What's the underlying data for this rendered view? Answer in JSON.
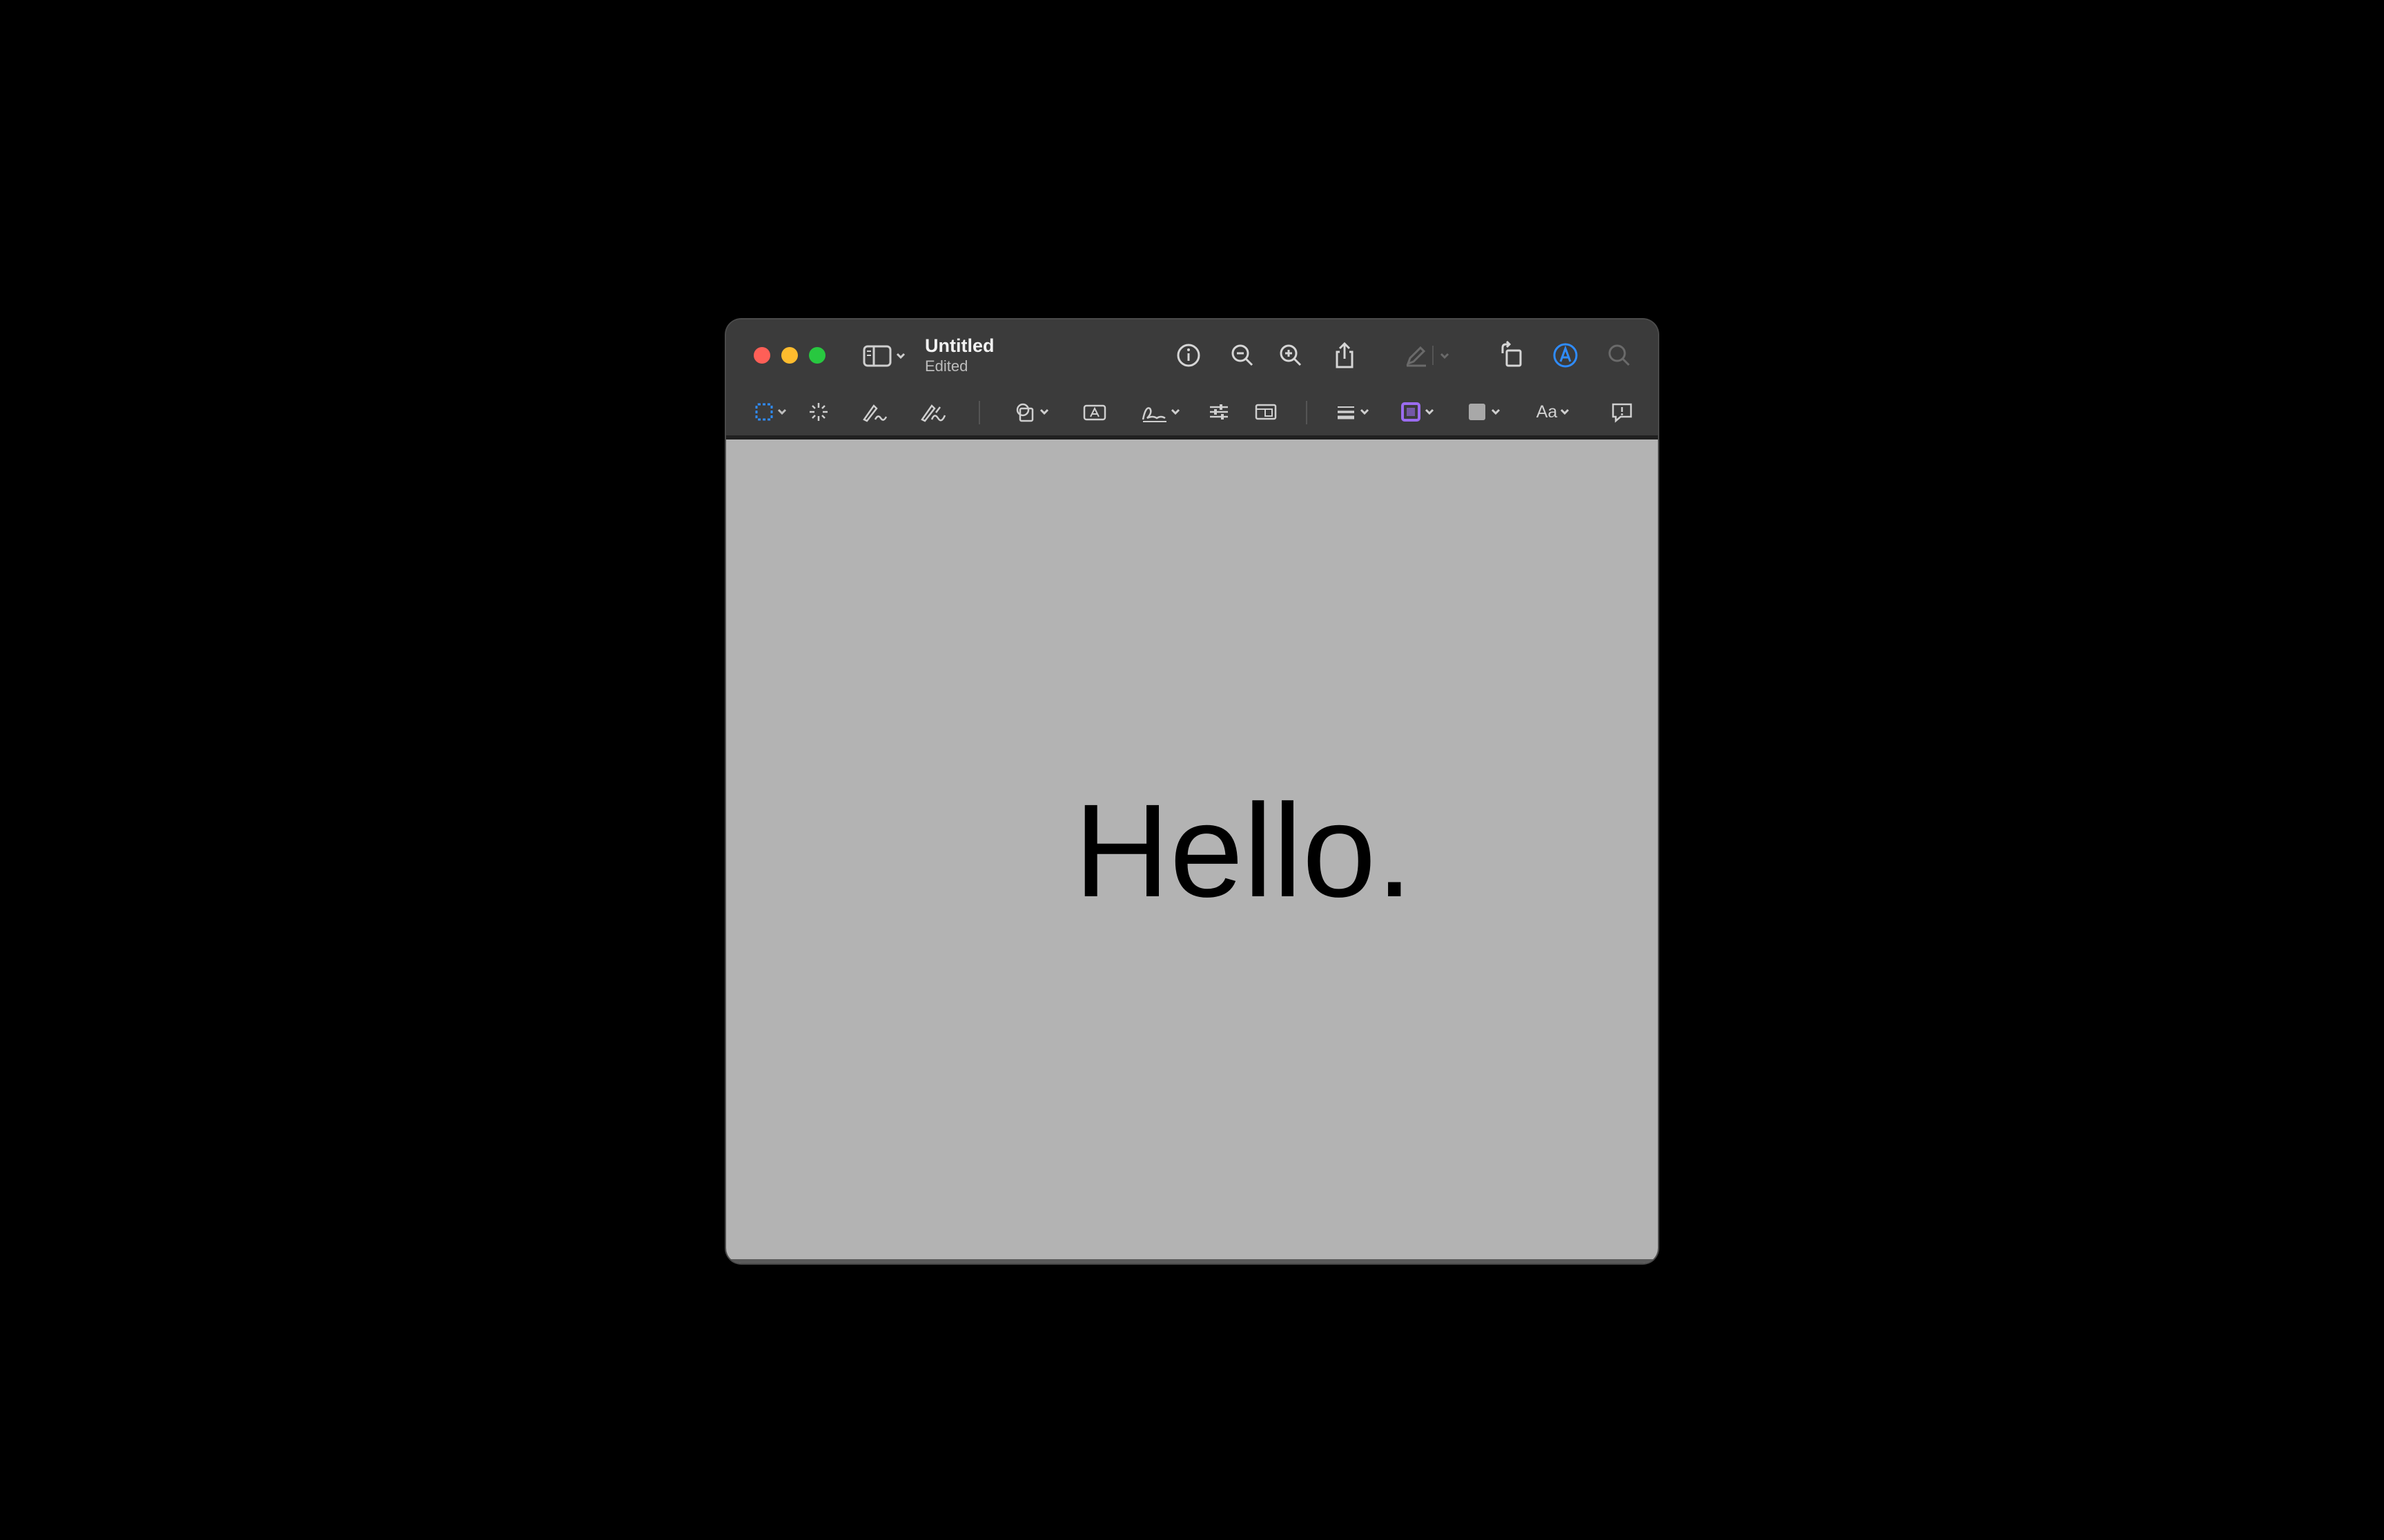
{
  "window": {
    "title": "Untitled",
    "subtitle": "Edited"
  },
  "titlebar_icons": {
    "sidebar": "sidebar-icon",
    "info": "info-icon",
    "zoom_out": "zoom-out-icon",
    "zoom_in": "zoom-in-icon",
    "share": "share-icon",
    "highlight": "highlight-pen-icon",
    "rotate": "rotate-icon",
    "markup": "markup-icon",
    "search": "search-icon"
  },
  "toolbar": {
    "font_label": "Aa",
    "border_color": "#9b6cf0",
    "fill_color": "#a8a8a8",
    "accent_color": "#2f8cff"
  },
  "document": {
    "text": "Hello."
  }
}
